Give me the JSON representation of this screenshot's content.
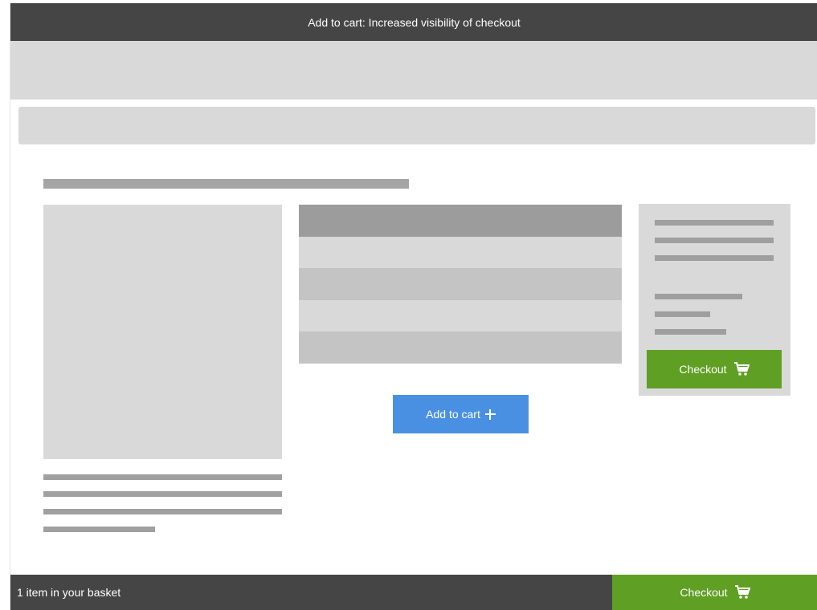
{
  "window": {
    "title": "Add to cart: Increased visibility of checkout"
  },
  "product": {
    "add_to_cart_label": "Add to cart",
    "add_to_cart_icon": "plus-icon"
  },
  "side_panel": {
    "checkout_label": "Checkout",
    "checkout_icon": "cart-icon"
  },
  "bottom_bar": {
    "basket_status": "1 item in your basket",
    "checkout_label": "Checkout",
    "checkout_icon": "cart-icon"
  },
  "colors": {
    "title_bar": "#454545",
    "placeholder_light": "#d9d9d9",
    "placeholder_dark": "#a3a3a3",
    "add_to_cart": "#4a90e2",
    "checkout": "#5f9f23"
  }
}
